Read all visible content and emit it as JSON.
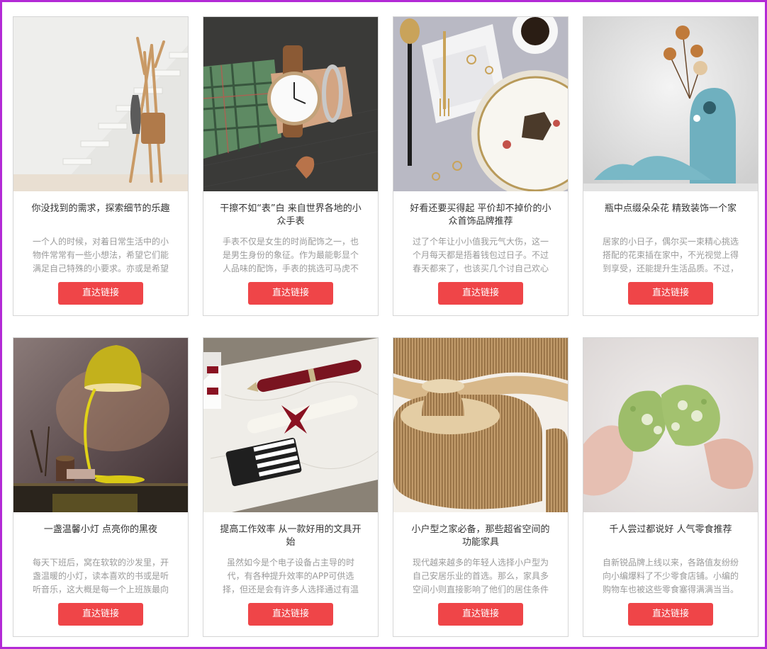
{
  "cards": [
    {
      "image": "coat-rack-photo",
      "title": "你没找到的需求，探索细节的乐趣",
      "desc": "一个人的时候，对着日常生活中的小物件常常有一些小想法，希望它们能满足自己特殊的小要求。亦或是希望同样的",
      "button": "直达链接"
    },
    {
      "image": "wristwatch-photo",
      "title": "干擦不如“表”白 来自世界各地的小众手表",
      "desc": "手表不仅是女生的时尚配饰之一，也是男生身份的象征。作为最能彰显个人品味的配饰，手表的挑选可马虎不得。但",
      "button": "直达链接"
    },
    {
      "image": "jewelry-tableware-photo",
      "title": "好看还要买得起 平价却不掉价的小众首饰品牌推荐",
      "desc": "过了个年让小小值我元气大伤，这一个月每天都是捂着钱包过日子。不过春天都来了，也该买几个讨自己欢心的小饰",
      "button": "直达链接"
    },
    {
      "image": "flower-vase-photo",
      "title": "瓶中点缀朵朵花 精致装饰一个家",
      "desc": "居家的小日子，偶尔买一束精心挑选搭配的花束插在家中，不光视觉上得到享受，还能提升生活品质。不过，鲜花易",
      "button": "直达链接"
    },
    {
      "image": "desk-lamp-photo",
      "title": "一盏温馨小灯 点亮你的黑夜",
      "desc": "每天下班后，窝在软软的沙发里，开盏温暖的小灯，读本喜欢的书或是听听音乐，这大概是每一个上班族最向往的生",
      "button": "直达链接"
    },
    {
      "image": "fountain-pen-photo",
      "title": "提高工作效率 从一款好用的文具开始",
      "desc": "虽然如今是个电子设备占主导的时代，有各种提升效率的APP可供选择，但还是会有许多人选择通过有温度的纸笔来",
      "button": "直达链接"
    },
    {
      "image": "paper-furniture-photo",
      "title": "小户型之家必备，那些超省空间的功能家具",
      "desc": "现代越来越多的年轻人选择小户型为自己安居乐业的首选。那么，家具多空间小则直接影响了他们的居住条件和心",
      "button": "直达链接"
    },
    {
      "image": "green-snack-photo",
      "title": "千人尝过都说好 人气零食推荐",
      "desc": "自新锐品牌上线以来，各路值友纷纷向小编爆料了不少零食店铺。小编的购物车也被这些零食塞得满满当当。不过，",
      "button": "直达链接"
    }
  ]
}
